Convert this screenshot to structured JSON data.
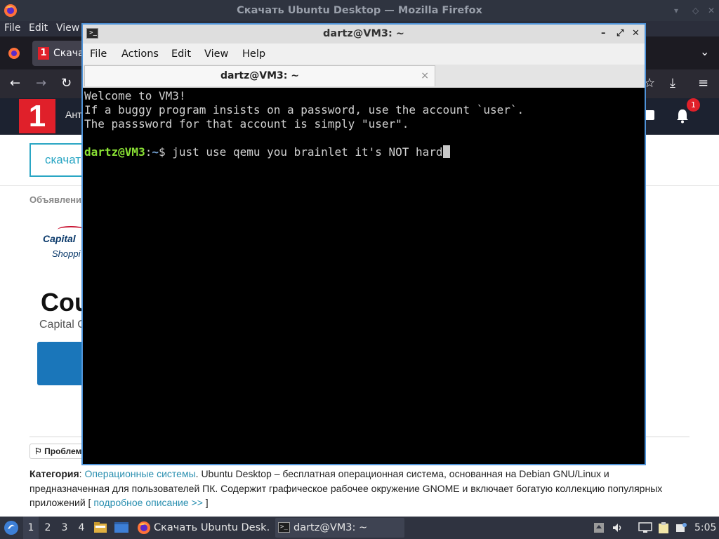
{
  "firefox": {
    "window_title": "Скачать Ubuntu Desktop — Mozilla Firefox",
    "menu": [
      "File",
      "Edit",
      "View"
    ],
    "tab_label": "Скача",
    "site_header_text": "Ант",
    "notification_count": "1",
    "page": {
      "download_button": "скачат",
      "ads_label": "Объявлени",
      "ad_brand_line1": "Capital",
      "ad_brand_line2": "Shoppi",
      "ad_headline": "Cou",
      "ad_subline": "Capital O",
      "problem_button": "Проблем",
      "category_label": "Категория",
      "category_link": "Операционные системы",
      "description": ". Ubuntu Desktop – бесплатная операционная система, основанная на Debian GNU/Linux и предназначенная для пользователей ПК. Содержит графическое рабочее окружение GNOME и включает богатую коллекцию популярных приложений [ ",
      "more_link": "подробное описание >>",
      "more_close": " ]"
    }
  },
  "terminal": {
    "window_title": "dartz@VM3: ~",
    "menu": [
      "File",
      "Actions",
      "Edit",
      "View",
      "Help"
    ],
    "tab_title": "dartz@VM3: ~",
    "tab_close": "×",
    "motd_lines": [
      "Welcome to VM3!",
      "If a buggy program insists on a password, use the account `user`.",
      "The passsword for that account is simply \"user\"."
    ],
    "prompt_user": "dartz@VM3",
    "prompt_sep": ":",
    "prompt_path": "~",
    "prompt_symbol": "$ ",
    "command": "just use qemu you brainlet it's NOT hard"
  },
  "taskbar": {
    "workspaces": [
      "1",
      "2",
      "3",
      "4"
    ],
    "tasks": [
      {
        "label": "Скачать Ubuntu Desk…",
        "icon": "firefox-icon"
      },
      {
        "label": "dartz@VM3: ~",
        "icon": "terminal-icon"
      }
    ],
    "clock": "5:05"
  }
}
